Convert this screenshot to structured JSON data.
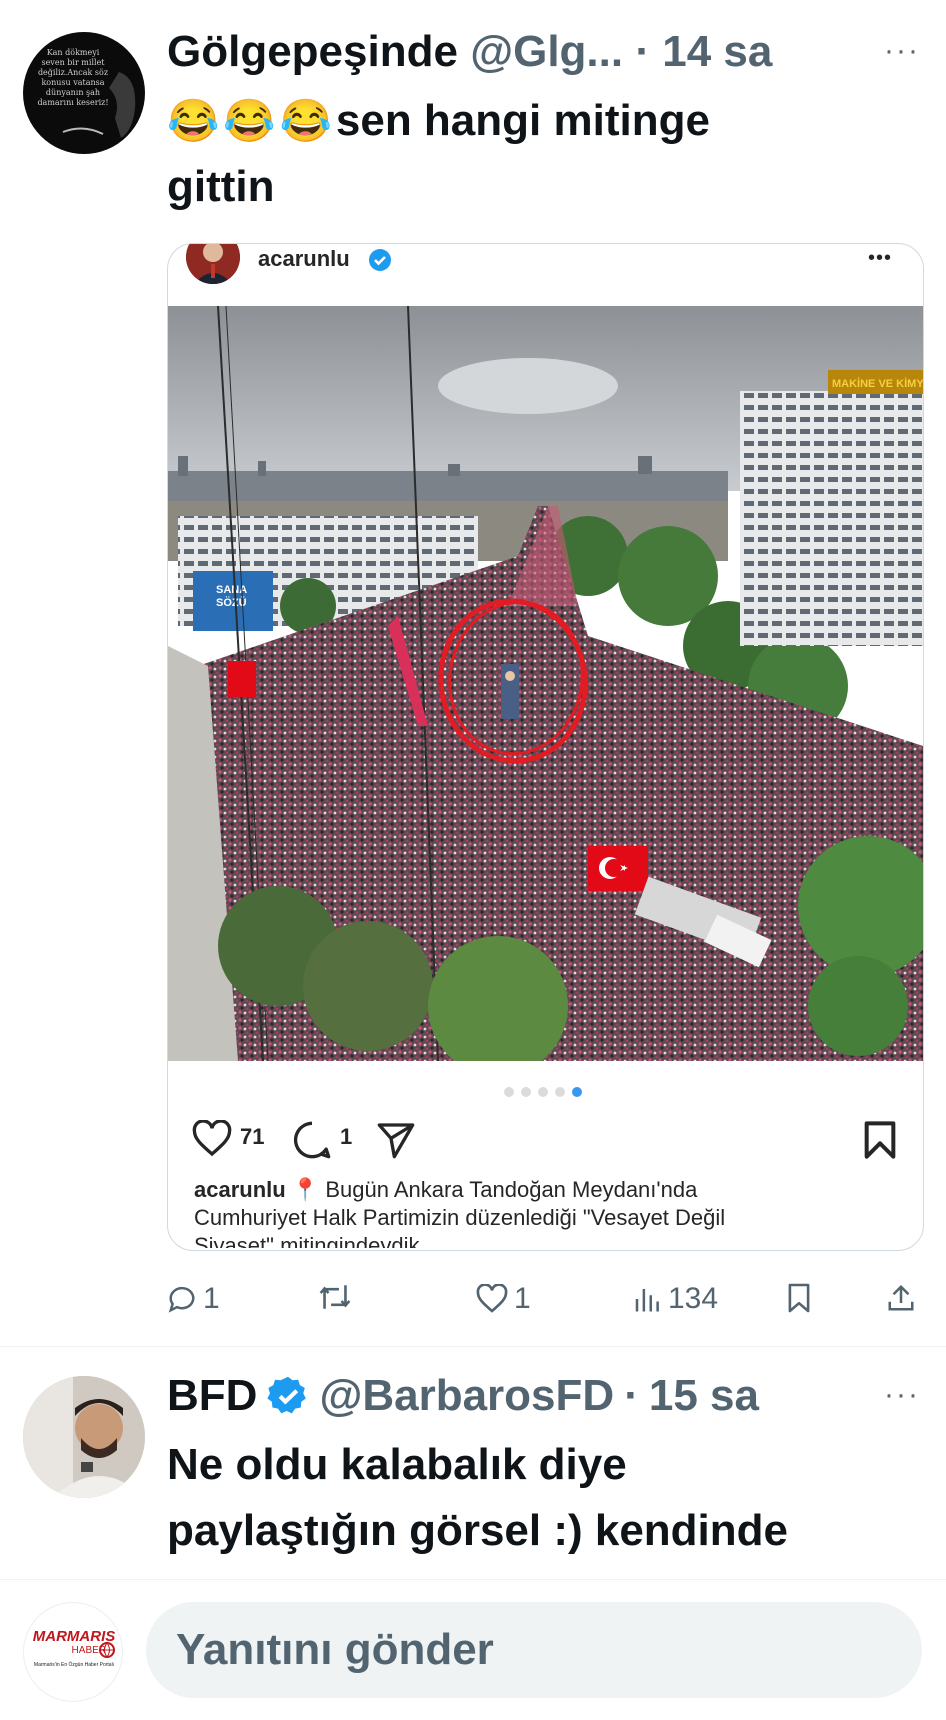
{
  "tweet1": {
    "display_name": "Gölgepeşinde",
    "handle": "@Glg...",
    "sep": "·",
    "time": "14 sa",
    "more": "···",
    "emojis": "😂😂😂",
    "text_line1": "sen hangi mitinge",
    "text_line2": "gittin",
    "avatar_text": "Kan dökmeyi seven bir millet değiliz.Ancak söz konusu vatansa dünyanın şah damarını keseriz!",
    "actions": {
      "replies": "1",
      "likes": "1",
      "views": "134"
    }
  },
  "embed": {
    "username": "acarunlu",
    "more": "•••",
    "building_sign": "MAKİNE VE KİMYA E",
    "billboard_line1": "SANA",
    "billboard_line2": "SÖZÜ",
    "likes": "71",
    "comments": "1",
    "caption_user": "acarunlu",
    "caption_line1": "📍 Bugün Ankara Tandoğan Meydanı'nda",
    "caption_line2": "Cumhuriyet Halk Partimizin düzenlediği \"Vesayet Değil",
    "caption_line3": "Siyaset\" mitingindeydik",
    "carousel_active": 5,
    "carousel_total": 5
  },
  "tweet2": {
    "display_name": "BFD",
    "handle": "@BarbarosFD",
    "sep": "·",
    "time": "15 sa",
    "more": "···",
    "text_line1": "Ne oldu kalabalık diye",
    "text_line2": "paylaştığın görsel :) kendinde"
  },
  "reply_bar": {
    "logo_line1": "MARMARIS",
    "logo_line2": "HABER",
    "logo_tagline": "Marmaris'in En Özgün Haber Portalı",
    "placeholder": "Yanıtını gönder"
  },
  "colors": {
    "verified": "#1d9bf0",
    "muted": "#536471",
    "text": "#0f1419",
    "flag_red": "#e30a17"
  }
}
